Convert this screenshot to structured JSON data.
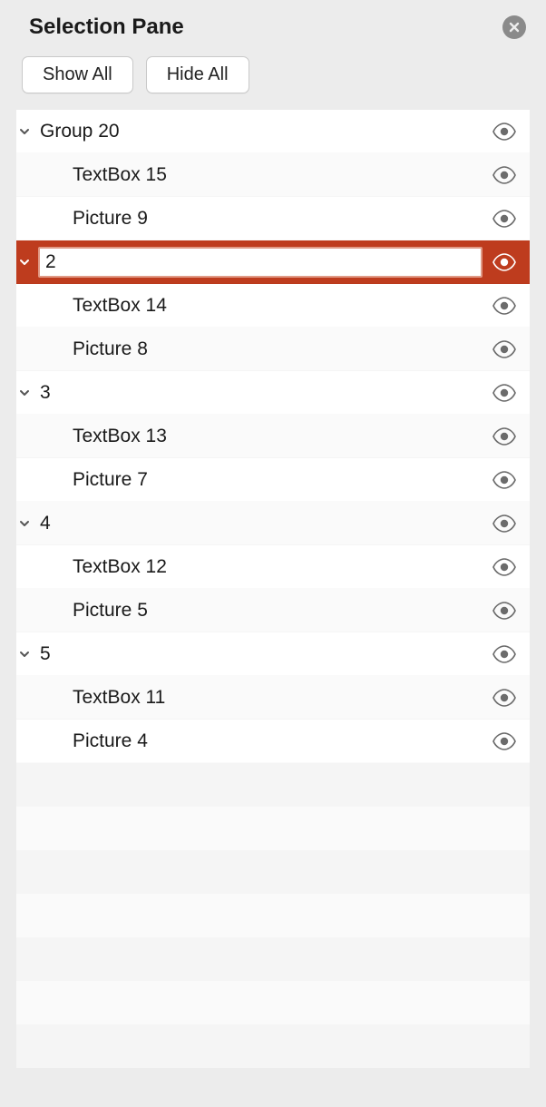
{
  "title": "Selection Pane",
  "buttons": {
    "show_all": "Show All",
    "hide_all": "Hide All"
  },
  "selected_edit_value": "2",
  "items": [
    {
      "label": "Group 20",
      "indent": 0,
      "expandable": true,
      "visible": true,
      "bg": "white"
    },
    {
      "label": "TextBox 15",
      "indent": 1,
      "expandable": false,
      "visible": true,
      "bg": "alt"
    },
    {
      "label": "Picture 9",
      "indent": 1,
      "expandable": false,
      "visible": true,
      "bg": "white"
    },
    {
      "label": "2",
      "indent": 0,
      "expandable": true,
      "visible": true,
      "bg": "selected",
      "editing": true
    },
    {
      "label": "TextBox 14",
      "indent": 1,
      "expandable": false,
      "visible": true,
      "bg": "white"
    },
    {
      "label": "Picture 8",
      "indent": 1,
      "expandable": false,
      "visible": true,
      "bg": "alt"
    },
    {
      "label": "3",
      "indent": 0,
      "expandable": true,
      "visible": true,
      "bg": "white"
    },
    {
      "label": "TextBox 13",
      "indent": 1,
      "expandable": false,
      "visible": true,
      "bg": "alt"
    },
    {
      "label": "Picture 7",
      "indent": 1,
      "expandable": false,
      "visible": true,
      "bg": "white"
    },
    {
      "label": "4",
      "indent": 0,
      "expandable": true,
      "visible": true,
      "bg": "alt"
    },
    {
      "label": "TextBox 12",
      "indent": 1,
      "expandable": false,
      "visible": true,
      "bg": "white"
    },
    {
      "label": "Picture 5",
      "indent": 1,
      "expandable": false,
      "visible": true,
      "bg": "alt"
    },
    {
      "label": "5",
      "indent": 0,
      "expandable": true,
      "visible": true,
      "bg": "white"
    },
    {
      "label": "TextBox 11",
      "indent": 1,
      "expandable": false,
      "visible": true,
      "bg": "alt"
    },
    {
      "label": "Picture 4",
      "indent": 1,
      "expandable": false,
      "visible": true,
      "bg": "white"
    }
  ],
  "empty_rows": 7,
  "colors": {
    "selected_bg": "#be3c1e",
    "input_border": "#e09a86"
  }
}
